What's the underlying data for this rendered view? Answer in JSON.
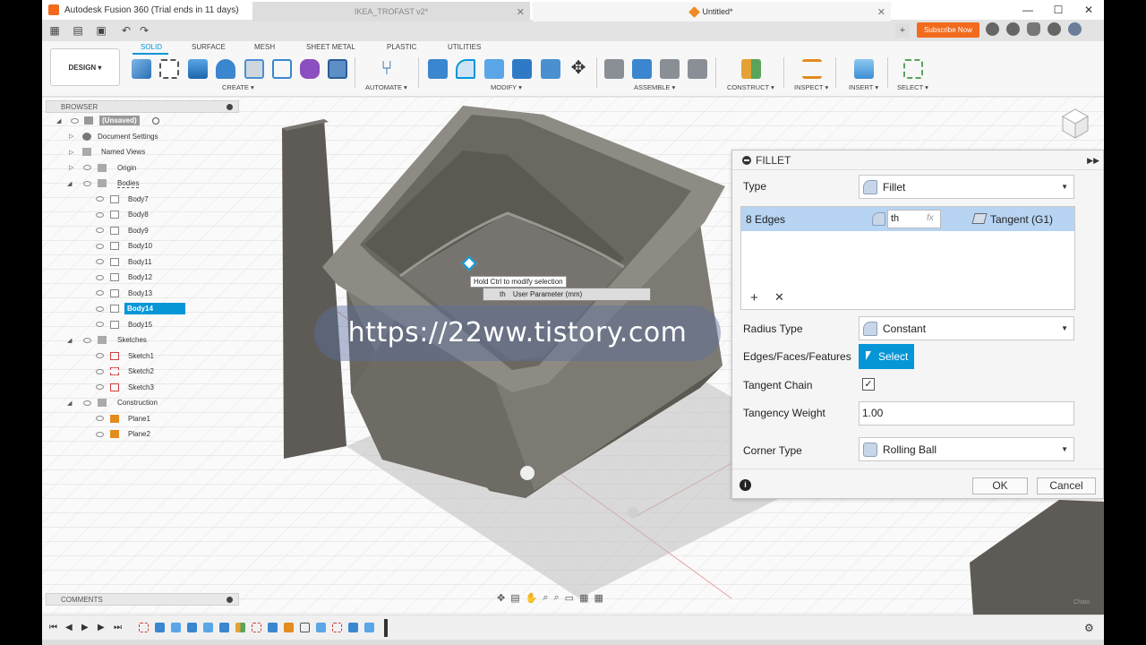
{
  "window": {
    "title": "Autodesk Fusion 360 (Trial ends in 11 days)"
  },
  "tabs": {
    "doc1": "IKEA_TROFAST v2*",
    "doc2": "Untitled*",
    "subscribe": "Subscribe Now"
  },
  "toolbar": {
    "workspace_button": "DESIGN ▾",
    "workspace_tabs": [
      "SOLID",
      "SURFACE",
      "MESH",
      "SHEET METAL",
      "PLASTIC",
      "UTILITIES"
    ],
    "groups": [
      "CREATE ▾",
      "AUTOMATE ▾",
      "MODIFY ▾",
      "ASSEMBLE ▾",
      "CONSTRUCT ▾",
      "INSPECT ▾",
      "INSERT ▾",
      "SELECT ▾"
    ]
  },
  "browser": {
    "header": "BROWSER",
    "root": "(Unsaved)",
    "document_settings": "Document Settings",
    "named_views": "Named Views",
    "origin": "Origin",
    "bodies": "Bodies",
    "body_items": [
      "Body7",
      "Body8",
      "Body9",
      "Body10",
      "Body11",
      "Body12",
      "Body13",
      "Body14",
      "Body15"
    ],
    "selected_body": "Body14",
    "sketches": "Sketches",
    "sketch_items": [
      "Sketch1",
      "Sketch2",
      "Sketch3"
    ],
    "construction": "Construction",
    "plane_items": [
      "Plane1",
      "Plane2"
    ]
  },
  "comments": {
    "header": "COMMENTS"
  },
  "tooltip": {
    "hint": "Hold Ctrl to modify selection",
    "param_name": "th",
    "param_desc": "User Parameter (mm)"
  },
  "watermark": "https://22ww.tistory.com",
  "fillet": {
    "title": "FILLET",
    "type_label": "Type",
    "type_value": "Fillet",
    "edges_count": "8 Edges",
    "radius_value": "th",
    "fx": "fx",
    "continuity": "Tangent (G1)",
    "radius_type_label": "Radius Type",
    "radius_type_value": "Constant",
    "efe_label": "Edges/Faces/Features",
    "select_button": "Select",
    "tangent_chain_label": "Tangent Chain",
    "tangent_chain_checked": true,
    "tangency_weight_label": "Tangency Weight",
    "tangency_weight_value": "1.00",
    "corner_type_label": "Corner Type",
    "corner_type_value": "Rolling Ball",
    "ok": "OK",
    "cancel": "Cancel"
  },
  "colors": {
    "accent": "#0696d7",
    "brand": "#f26b1d",
    "body_gray": "#6f6c66"
  }
}
